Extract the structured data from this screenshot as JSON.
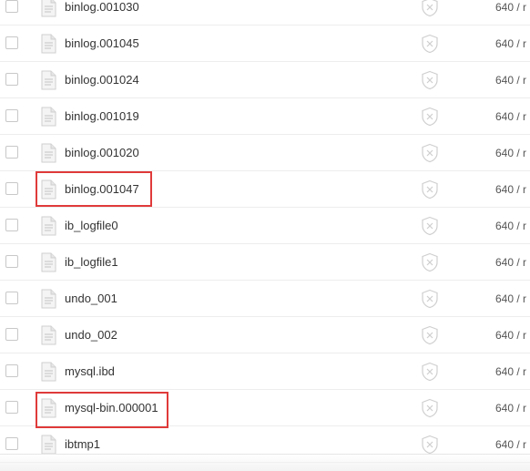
{
  "files": [
    {
      "name": "binlog.001030",
      "perm": "640 / r"
    },
    {
      "name": "binlog.001045",
      "perm": "640 / r"
    },
    {
      "name": "binlog.001024",
      "perm": "640 / r"
    },
    {
      "name": "binlog.001019",
      "perm": "640 / r"
    },
    {
      "name": "binlog.001020",
      "perm": "640 / r"
    },
    {
      "name": "binlog.001047",
      "perm": "640 / r"
    },
    {
      "name": "ib_logfile0",
      "perm": "640 / r"
    },
    {
      "name": "ib_logfile1",
      "perm": "640 / r"
    },
    {
      "name": "undo_001",
      "perm": "640 / r"
    },
    {
      "name": "undo_002",
      "perm": "640 / r"
    },
    {
      "name": "mysql.ibd",
      "perm": "640 / r"
    },
    {
      "name": "mysql-bin.000001",
      "perm": "640 / r"
    },
    {
      "name": "ibtmp1",
      "perm": "640 / r"
    }
  ],
  "highlighted_files": [
    "binlog.001047",
    "mysql-bin.000001"
  ],
  "colors": {
    "highlight_border": "#e03a3a",
    "row_divider": "#ededed",
    "text": "#333333"
  },
  "icons": {
    "file": "file-icon",
    "protection": "shield-x-icon",
    "checkbox": "checkbox-icon"
  }
}
